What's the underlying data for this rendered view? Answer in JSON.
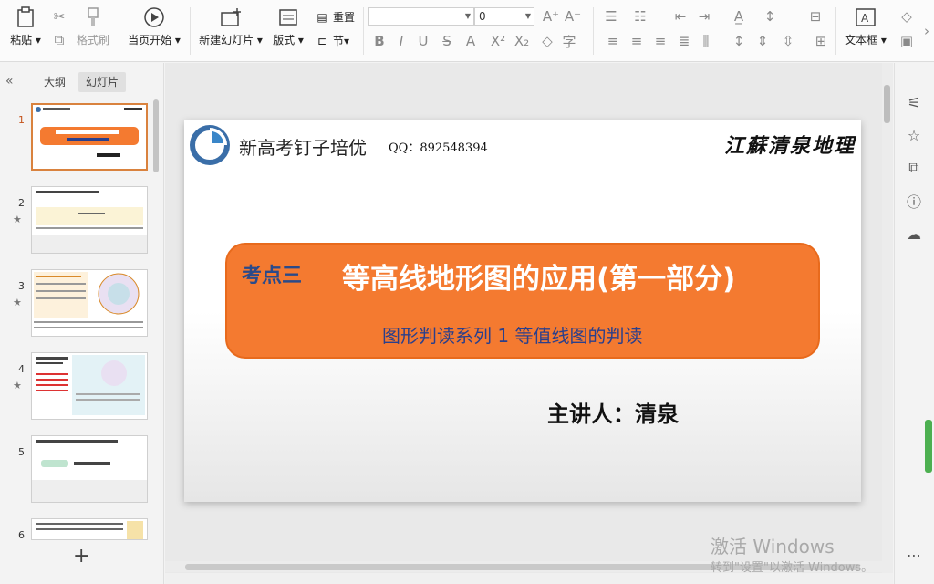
{
  "ribbon": {
    "paste_label": "粘贴",
    "format_painter_label": "格式刷",
    "from_current_label": "当页开始",
    "new_slide_label": "新建幻灯片",
    "layout_label": "版式",
    "reset_label": "重置",
    "section_label": "节",
    "font_size_value": "0",
    "textbox_label": "文本框"
  },
  "left_panel": {
    "outline_tab": "大纲",
    "slides_tab": "幻灯片",
    "thumbnails": [
      {
        "num": "1",
        "starred": false
      },
      {
        "num": "2",
        "starred": true
      },
      {
        "num": "3",
        "starred": true
      },
      {
        "num": "4",
        "starred": true
      },
      {
        "num": "5",
        "starred": false
      },
      {
        "num": "6",
        "starred": false
      }
    ],
    "add_symbol": "+"
  },
  "slide": {
    "brand": "新高考钉子培优",
    "qq": "QQ：892548394",
    "calligraphy": "江蘇清泉地理",
    "topic_tag": "考点三",
    "main_title": "等高线地形图的应用(第一部分)",
    "sub_title": "图形判读系列  1  等值线图的判读",
    "presenter": "主讲人：清泉"
  },
  "watermark": {
    "line1": "激活 Windows",
    "line2": "转到\"设置\"以激活 Windows。"
  },
  "colors": {
    "accent_orange": "#f47a30",
    "title_blue": "#2a4a8a",
    "active_thumb_border": "#d9823e"
  }
}
